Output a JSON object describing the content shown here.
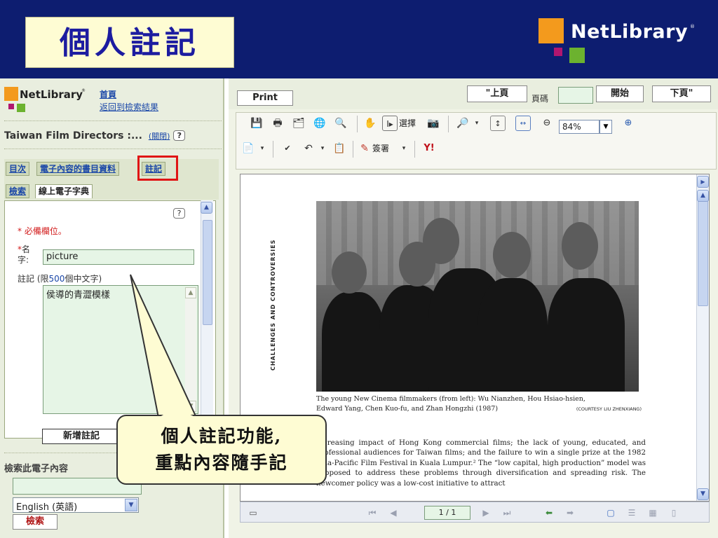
{
  "slide": {
    "title": "個人註記"
  },
  "brand": {
    "name": "NetLibrary",
    "registered": "®"
  },
  "left": {
    "logo_name": "NetLibrary",
    "logo_reg": "®",
    "home_link": "首頁",
    "back_link": "返回到檢索結果",
    "book_title": "Taiwan Film Directors :...",
    "open_link": "(關閉)",
    "help": "?",
    "tabs_row1": [
      "目次",
      "電子內容的書目資料",
      "註記"
    ],
    "tabs_row2": [
      "檢索",
      "線上電子字典"
    ],
    "required_note": "* 必備欄位。",
    "name_label_star": "*",
    "name_label": "名字:",
    "name_value": "picture",
    "note_label": "註記",
    "note_limit_prefix": "(限",
    "note_limit_num": "500",
    "note_limit_suffix": "個中文字)",
    "note_value": "侯導的青澀模樣",
    "add_button": "新增註記",
    "search_section_title": "檢索此電子內容",
    "search_value": "",
    "language_selected": "English (英語)",
    "search_button": "檢索"
  },
  "right": {
    "print_button": "Print",
    "prev_button": "\"上頁",
    "page_label": "頁碼",
    "go_button": "開始",
    "next_button": "下頁\"",
    "select_label": "選擇",
    "bookmark_label": "簽署",
    "zoom": "84%",
    "page_indicator": "1 / 1",
    "doc": {
      "side_text": "CHALLENGES AND CONTROVERSIES",
      "caption_line1": "The young New Cinema filmmakers (from left): Wu Nianzhen, Hou Hsiao-hsien,",
      "caption_line2": "Edward Yang, Chen Kuo-fu, and Zhan Hongzhi (1987)",
      "credit": "(COURTESY LIU ZHENXIANG)",
      "body": "increasing impact of Hong Kong commercial films; the lack of young, educated, and professional audiences for Taiwan films; and the failure to win a single prize at the 1982 Asia-Pacific Film Festival in Kuala Lumpur.² The “low capital, high production” model was supposed to address these problems through diversification and spreading risk. The newcomer policy was a low-cost initiative to attract"
    }
  },
  "callout": {
    "line1": "個人註記功能,",
    "line2": "重點內容隨手記"
  },
  "colors": {
    "slide_bg": "#0d1d70",
    "title_box": "#fefcd3",
    "title_text": "#1c1ca0",
    "highlight": "#e01515",
    "logo_orange": "#f39a1d",
    "logo_magenta": "#b0166f",
    "logo_green": "#6cb22f"
  }
}
